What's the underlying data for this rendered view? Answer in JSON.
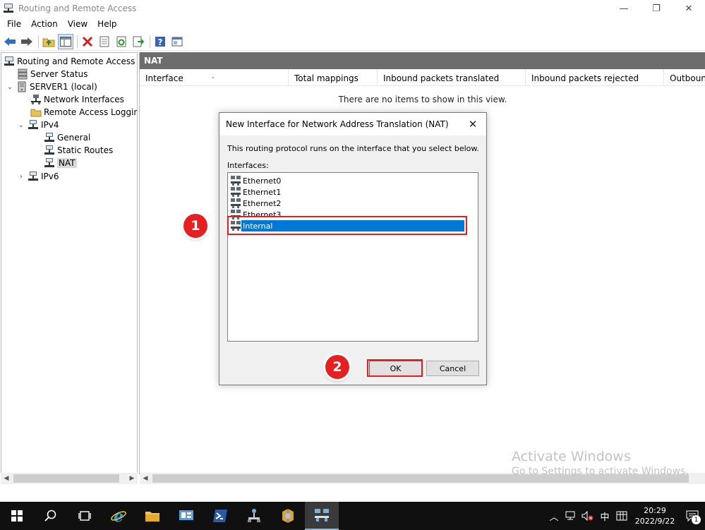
{
  "window": {
    "title": "Routing and Remote Access",
    "minimize": "—",
    "maximize": "❐",
    "close": "✕"
  },
  "menu": [
    "File",
    "Action",
    "View",
    "Help"
  ],
  "tree": {
    "items": [
      {
        "label": "Routing and Remote Access",
        "level": 0,
        "chevron": ""
      },
      {
        "label": "Server Status",
        "level": 1,
        "chevron": ""
      },
      {
        "label": "SERVER1 (local)",
        "level": 1,
        "chevron": "⌄"
      },
      {
        "label": "Network Interfaces",
        "level": 2,
        "chevron": ""
      },
      {
        "label": "Remote Access Logging",
        "level": 2,
        "chevron": ""
      },
      {
        "label": "IPv4",
        "level": 2,
        "chevron": "⌄"
      },
      {
        "label": "General",
        "level": 3,
        "chevron": ""
      },
      {
        "label": "Static Routes",
        "level": 3,
        "chevron": ""
      },
      {
        "label": "NAT",
        "level": 3,
        "chevron": ""
      },
      {
        "label": "IPv6",
        "level": 2,
        "chevron": "›"
      }
    ]
  },
  "content": {
    "header": "NAT",
    "columns": [
      "Interface",
      "Total mappings",
      "Inbound packets translated",
      "Inbound packets rejected",
      "Outbound"
    ],
    "empty_message": "There are no items to show in this view."
  },
  "dialog": {
    "title": "New Interface for Network Address Translation (NAT)",
    "description": "This routing protocol runs on the interface that you select below.",
    "list_label": "Interfaces:",
    "interfaces": [
      "Ethernet0",
      "Ethernet1",
      "Ethernet2",
      "Ethernet3",
      "Internal"
    ],
    "selected": "Internal",
    "ok_label": "OK",
    "cancel_label": "Cancel"
  },
  "callouts": {
    "step1": "1",
    "step2": "2"
  },
  "watermark": {
    "line1": "Activate Windows",
    "line2": "Go to Settings to activate Windows."
  },
  "taskbar": {
    "ime": "中",
    "time": "20:29",
    "date": "2022/9/22",
    "notification_count": "1"
  },
  "colors": {
    "selection": "#0078d7",
    "callout": "#e52020",
    "header_bar": "#6d6d6d"
  }
}
